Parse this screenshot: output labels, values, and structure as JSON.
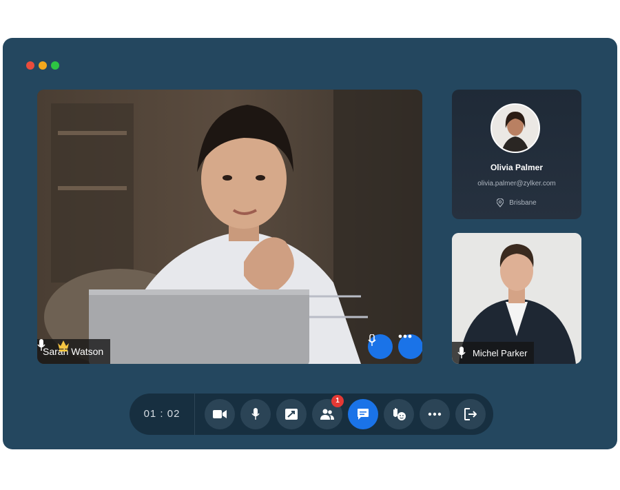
{
  "window": {
    "dots": [
      "#ea4c3c",
      "#f2a81d",
      "#2dc443"
    ]
  },
  "main_video": {
    "participant": "Sarah Watson",
    "mic_icon": "mic-icon",
    "host_icon": "crown-icon"
  },
  "profile_card": {
    "name": "Olivia Palmer",
    "email": "olivia.palmer@zylker.com",
    "location": "Brisbane"
  },
  "tile2": {
    "participant": "Michel Parker"
  },
  "toolbar": {
    "timer": "01 : 02",
    "participants_badge": "1",
    "buttons": [
      "video-camera-icon",
      "mic-icon",
      "screen-share-icon",
      "participants-icon",
      "chat-icon",
      "raise-hand-icon",
      "more-icon",
      "leave-icon"
    ]
  },
  "colors": {
    "window_bg": "#24475f",
    "accent": "#1a73e8",
    "badge": "#e53935"
  }
}
